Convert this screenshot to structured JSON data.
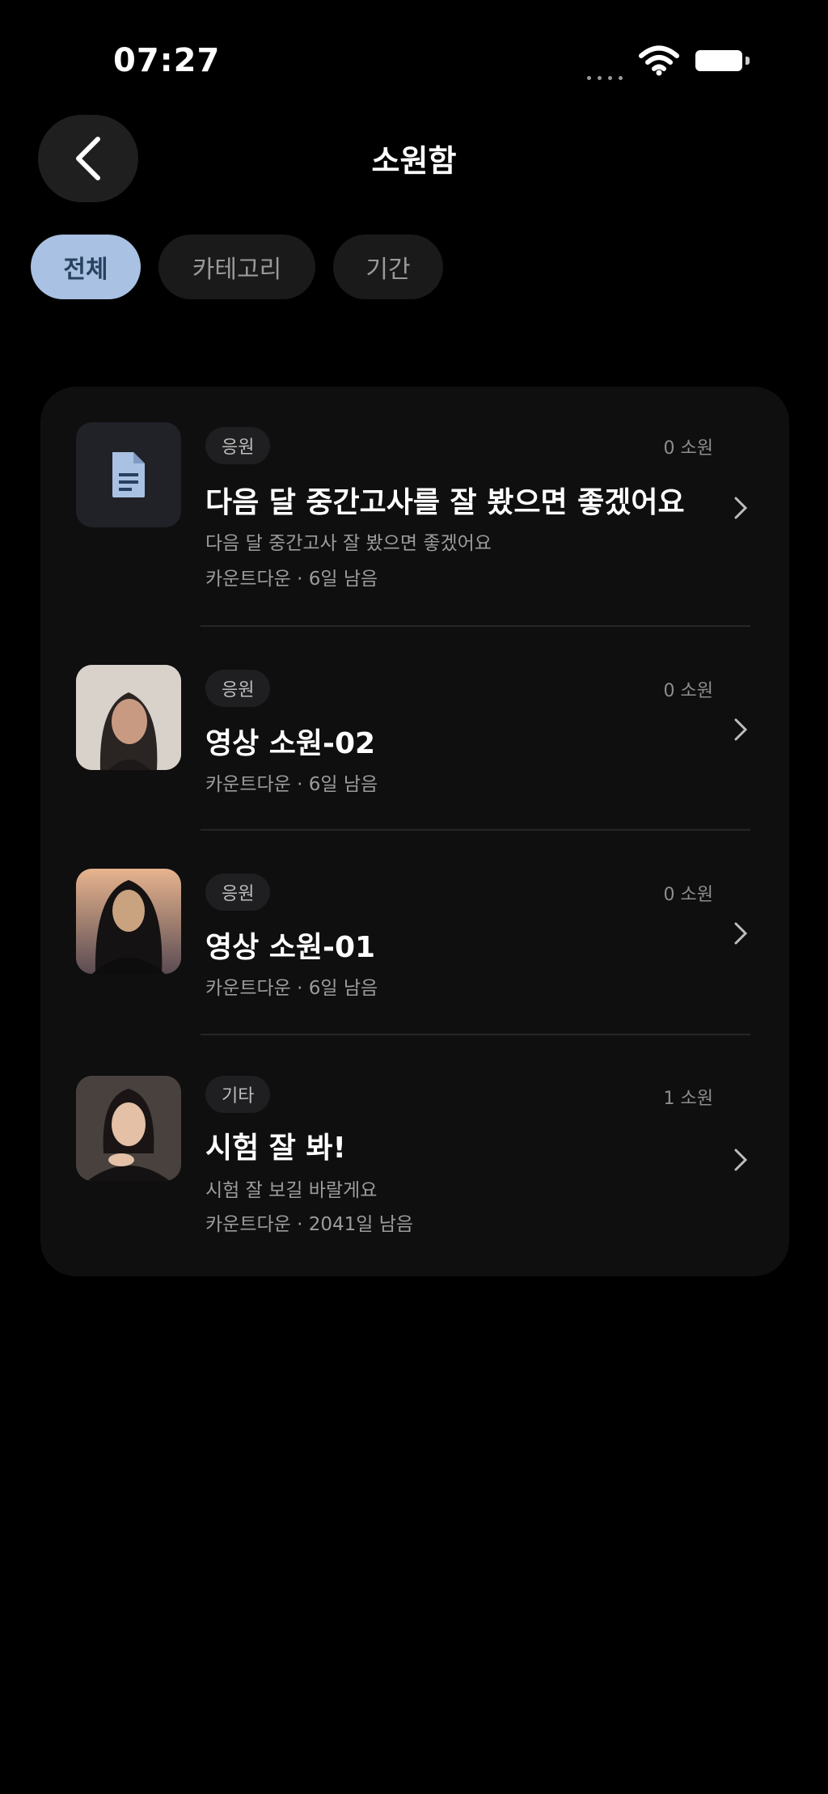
{
  "status_bar": {
    "time": "07:27"
  },
  "header": {
    "title": "소원함"
  },
  "filters": [
    {
      "label": "전체",
      "active": true
    },
    {
      "label": "카테고리",
      "active": false
    },
    {
      "label": "기간",
      "active": false
    }
  ],
  "items": [
    {
      "thumb": "document-icon",
      "tag": "응원",
      "owner": "0 소원",
      "title": "다음 달 중간고사를 잘 봤으면 좋겠어요",
      "description": "다음 달 중간고사 잘 봤으면 좋겠어요",
      "meta": "카운트다운 · 6일 남음"
    },
    {
      "thumb": "avatar",
      "tag": "응원",
      "owner": "0 소원",
      "title": "영상 소원-02",
      "description": "",
      "meta": "카운트다운 · 6일 남음"
    },
    {
      "thumb": "avatar",
      "tag": "응원",
      "owner": "0 소원",
      "title": "영상 소원-01",
      "description": "",
      "meta": "카운트다운 · 6일 남음"
    },
    {
      "thumb": "avatar",
      "tag": "기타",
      "owner": "1 소원",
      "title": "시험 잘 봐!",
      "description": "시험 잘 보길 바랄게요",
      "meta": "카운트다운 · 2041일 남음"
    }
  ]
}
